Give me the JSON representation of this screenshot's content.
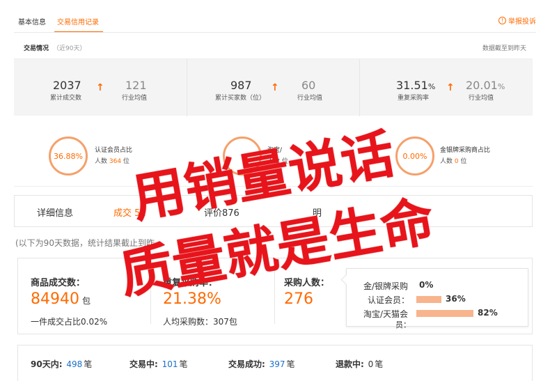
{
  "tabs": {
    "basic": "基本信息",
    "credit": "交易信用记录",
    "report": "举报投诉"
  },
  "section": {
    "title": "交易情况",
    "sub": "（近90天）",
    "note": "数据截至到昨天"
  },
  "stats": [
    {
      "value": "2037",
      "unit": "",
      "label": "累计成交数",
      "avg": "121",
      "avg_unit": "",
      "avg_label": "行业均值"
    },
    {
      "value": "987",
      "unit": "",
      "label": "累计买家数（位）",
      "avg": "60",
      "avg_unit": "",
      "avg_label": "行业均值"
    },
    {
      "value": "31.51",
      "unit": "%",
      "label": "重复采购率",
      "avg": "20.01",
      "avg_unit": "%",
      "avg_label": "行业均值"
    }
  ],
  "rings": [
    {
      "pct": "36.88%",
      "title": "认证会员占比",
      "sub_prefix": "人数 ",
      "num": "364",
      "sub_suffix": " 位"
    },
    {
      "pct": "",
      "title": "淘宝/",
      "sub_prefix": "人数 ",
      "num": "",
      "sub_suffix": " 位"
    },
    {
      "pct": "0.00%",
      "title": "金银牌采购商占比",
      "sub_prefix": "人数 ",
      "num": "0",
      "sub_suffix": " 位"
    }
  ],
  "detail_tabs": {
    "info": "详细信息",
    "deal": "成交 51",
    "review": "评价876",
    "other": "明"
  },
  "note": "(以下为90天数据，统计结果截止到昨",
  "summary": {
    "deals": {
      "title": "商品成交数：",
      "value": "84940",
      "unit": "包",
      "sub": "一件成交占比0.02%"
    },
    "repeat": {
      "title": "重复采购率：",
      "value": "21.38%",
      "sub": "人均采购数：307包"
    },
    "buyers": {
      "title": "采购人数：",
      "value": "276"
    }
  },
  "buyer_bars": [
    {
      "label": "金/银牌采购",
      "label2": "",
      "pct": "0%",
      "value": 0
    },
    {
      "label": "认证会员：",
      "label2": "",
      "pct": "36%",
      "value": 36
    },
    {
      "label": "淘宝/天猫会",
      "label2": "员：",
      "pct": "82%",
      "value": 82
    }
  ],
  "footer": [
    {
      "label": "90天内:",
      "num": "498",
      "unit": "笔"
    },
    {
      "label": "交易中:",
      "num": "101",
      "unit": "笔"
    },
    {
      "label": "交易成功:",
      "num": "397",
      "unit": "笔"
    },
    {
      "label": "退款中:",
      "num": "0",
      "unit": "笔"
    }
  ],
  "overlay": {
    "line1": "用销量说话",
    "line2": "质量就是生命"
  },
  "colors": {
    "accent": "#ff6a00",
    "overlay": "#e8141b",
    "link": "#1a6fc8",
    "bar": "#f8b48c"
  }
}
